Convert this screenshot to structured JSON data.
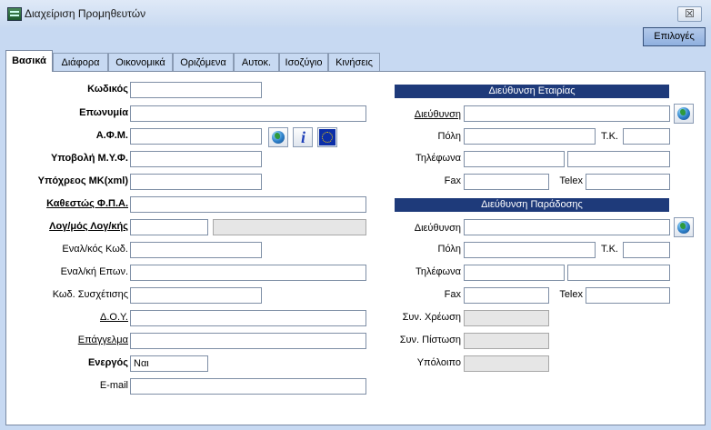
{
  "window": {
    "title": "Διαχείριση Προμηθευτών",
    "close_glyph": "☒",
    "options_label": "Επιλογές"
  },
  "tabs": [
    "Βασικά",
    "Διάφορα",
    "Οικονομικά",
    "Οριζόμενα",
    "Αυτοκ.",
    "Ισοζύγιο",
    "Κινήσεις"
  ],
  "left": {
    "code_label": "Κωδικός",
    "name_label": "Επωνυμία",
    "afm_label": "Α.Φ.Μ.",
    "myf_submission_label": "Υποβολή Μ.Υ.Φ.",
    "mk_xml_label": "Υπόχρεος ΜΚ(xml)",
    "vat_status_label": "Καθεστώς Φ.Π.Α.",
    "account_label": "Λογ/μός Λογ/κής",
    "alt_code_label": "Εναλ/κός Κωδ.",
    "alt_name_label": "Εναλ/κή Επων.",
    "relation_code_label": "Κωδ. Συσχέτισης",
    "tax_office_label": "Δ.Ο.Υ.",
    "profession_label": "Επάγγελμα",
    "active_label": "Ενεργός",
    "active_value": "Ναι",
    "email_label": "E-mail"
  },
  "company_address": {
    "title": "Διεύθυνση Εταιρίας",
    "address_label": "Διεύθυνση",
    "city_label": "Πόλη",
    "zip_label": "Τ.Κ.",
    "phones_label": "Τηλέφωνα",
    "fax_label": "Fax",
    "telex_label": "Telex"
  },
  "delivery_address": {
    "title": "Διεύθυνση Παράδοσης",
    "address_label": "Διεύθυνση",
    "city_label": "Πόλη",
    "zip_label": "Τ.Κ.",
    "phones_label": "Τηλέφωνα",
    "fax_label": "Fax",
    "telex_label": "Telex"
  },
  "balances": {
    "debit_label": "Συν. Χρέωση",
    "credit_label": "Συν. Πίστωση",
    "balance_label": "Υπόλοιπο"
  },
  "icons": {
    "globe": "globe-icon",
    "info": "info-icon",
    "eu": "eu-flag-icon"
  }
}
